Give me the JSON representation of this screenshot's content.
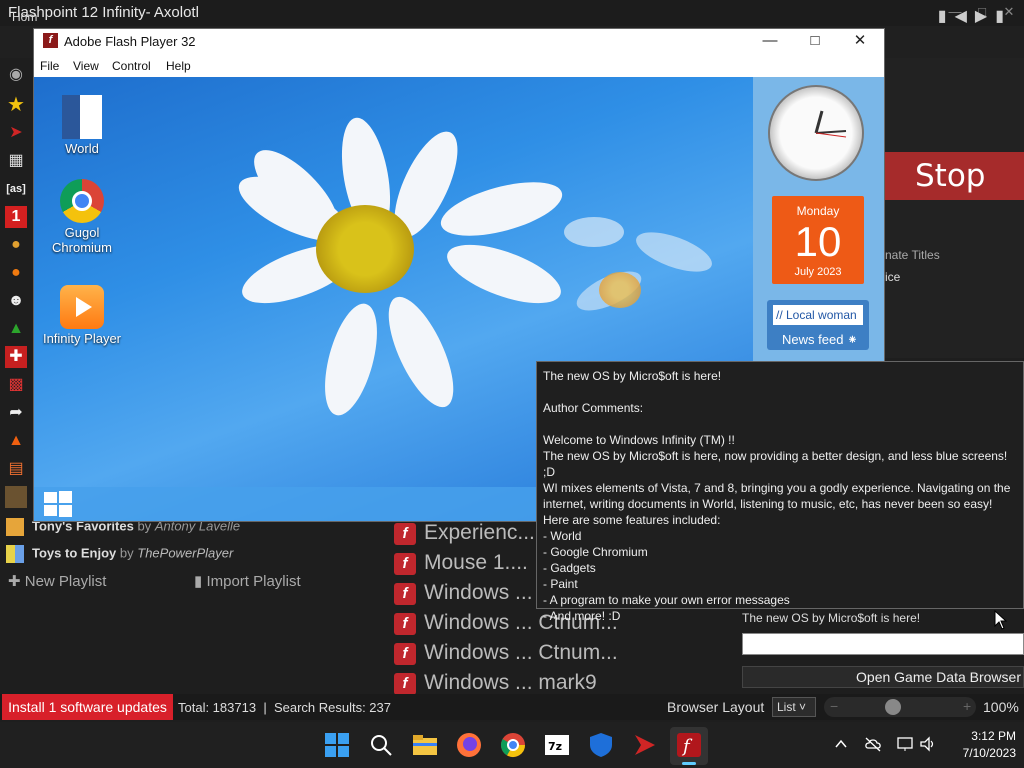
{
  "app": {
    "title": "Flashpoint 12 Infinity- Axolotl",
    "home_tab": "Hom",
    "stop_label": "Stop",
    "alt_titles_partial": "nate Titles",
    "field_partial": "ice"
  },
  "flash_window": {
    "title": "Adobe Flash Player 32",
    "menu": [
      "File",
      "View",
      "Control",
      "Help"
    ],
    "desktop_icons": [
      {
        "label": "World",
        "icon": "word-icon"
      },
      {
        "label": "Gugol Chromium",
        "icon": "chrome-icon"
      },
      {
        "label": "Infinity Player",
        "icon": "media-player-icon"
      }
    ],
    "calendar": {
      "day": "Monday",
      "date": "10",
      "month": "July 2023"
    },
    "news": {
      "headline": "// Local woman",
      "label": "News feed"
    }
  },
  "tooltip": {
    "lines": [
      "The new OS by Micro$oft is here!",
      "",
      "Author Comments:",
      "",
      "Welcome to Windows Infinity (TM) !!",
      "The new OS by Micro$oft is here, now providing a better design, and less blue screens! ;D",
      "WI mixes elements of Vista, 7 and 8, bringing you a godly experience. Navigating on the internet, writing documents in World, listening to music, etc, has never been so easy!",
      "Here are some features included:",
      "- World",
      "- Google Chromium",
      "- Gadgets",
      "- Paint",
      "- A program to make your own error messages",
      "- And more! :D"
    ]
  },
  "playlists": [
    {
      "name": "Tony's Favorites",
      "by": "by",
      "author": "Antony Lavelle"
    },
    {
      "name": "Toys to Enjoy",
      "by": "by",
      "author": "ThePowerPlayer"
    }
  ],
  "playlist_actions": {
    "new": "New Playlist",
    "import": "Import Playlist"
  },
  "games": [
    "Experienc...",
    "Mouse 1....",
    "Windows ...",
    "Windows ... Ctnum...",
    "Windows ... Ctnum...",
    "Windows ... mark9"
  ],
  "game_info": {
    "title": "The new OS by Micro$oft is here!",
    "open_browser": "Open Game Data Browser"
  },
  "status": {
    "updates": "Install 1 software updates",
    "total": "Total: 183713",
    "separator": "|",
    "results": "Search Results: 237",
    "layout_label": "Browser Layout",
    "layout_value": "List",
    "zoom_minus": "−",
    "zoom_plus": "+",
    "zoom": "100%",
    "zoom_level": 0.45
  },
  "taskbar": {
    "time": "3:12 PM",
    "date": "7/10/2023"
  },
  "colors": {
    "stop": "#a62b2b",
    "updates": "#d8202a",
    "flash": "#c0272d"
  }
}
